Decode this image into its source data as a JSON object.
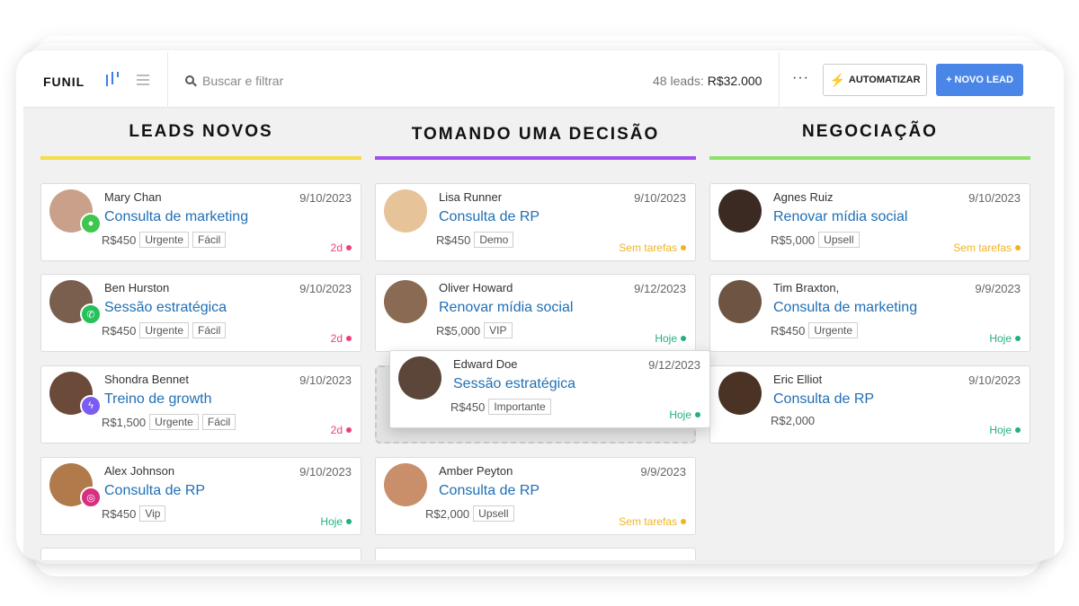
{
  "toolbar": {
    "title": "FUNIL",
    "search_placeholder": "Buscar e filtrar",
    "leads_count": "48 leads:",
    "leads_total": "R$32.000",
    "more": "···",
    "automate_label": "AUTOMATIZAR",
    "new_lead_label": "+ NOVO LEAD"
  },
  "colors": {
    "accent": "#4a86e8",
    "link": "#1f6fb5",
    "today": "#22b07d",
    "no_tasks": "#f0b323",
    "overdue": "#ec407a"
  },
  "columns": [
    {
      "title": "LEADS NOVOS",
      "line_color": "#f4dc4a",
      "cards": [
        {
          "name": "Mary Chan",
          "date": "9/10/2023",
          "title": "Consulta de marketing",
          "price": "R$450",
          "tags": [
            "Urgente",
            "Fácil"
          ],
          "status": "2d",
          "status_kind": "overdue",
          "channel": "chat-icon",
          "avatar_color": "#c9a18a"
        },
        {
          "name": "Ben Hurston",
          "date": "9/10/2023",
          "title": "Sessão estratégica",
          "price": "R$450",
          "tags": [
            "Urgente",
            "Fácil"
          ],
          "status": "2d",
          "status_kind": "overdue",
          "channel": "whatsapp-icon",
          "avatar_color": "#7a5f4e"
        },
        {
          "name": "Shondra Bennet",
          "date": "9/10/2023",
          "title": "Treino de growth",
          "price": "R$1,500",
          "tags": [
            "Urgente",
            "Fácil"
          ],
          "status": "2d",
          "status_kind": "overdue",
          "channel": "messenger-icon",
          "avatar_color": "#6b4a3a"
        },
        {
          "name": "Alex Johnson",
          "date": "9/10/2023",
          "title": "Consulta de RP",
          "price": "R$450",
          "tags": [
            "Vip"
          ],
          "status": "Hoje",
          "status_kind": "today",
          "channel": "instagram-icon",
          "avatar_color": "#b07a4a"
        }
      ]
    },
    {
      "title": "TOMANDO UMA DECISÃO",
      "line_color": "#a14ef2",
      "cards": [
        {
          "name": "Lisa Runner",
          "date": "9/10/2023",
          "title": "Consulta de RP",
          "price": "R$450",
          "tags": [
            "Demo"
          ],
          "status": "Sem tarefas",
          "status_kind": "no_tasks",
          "channel": "",
          "avatar_color": "#e7c39a"
        },
        {
          "name": "Oliver Howard",
          "date": "9/12/2023",
          "title": "Renovar mídia social",
          "price": "R$5,000",
          "tags": [
            "VIP"
          ],
          "status": "Hoje",
          "status_kind": "today",
          "channel": "",
          "avatar_color": "#8a6a52"
        },
        {
          "name": "Amber Peyton",
          "date": "9/9/2023",
          "title": "Consulta de RP",
          "price": "R$2,000",
          "tags": [
            "Upsell"
          ],
          "status": "Sem tarefas",
          "status_kind": "no_tasks",
          "channel": "",
          "avatar_color": "#c98f6b"
        }
      ],
      "dragged_card": {
        "name": "Edward Doe",
        "date": "9/12/2023",
        "title": "Sessão estratégica",
        "price": "R$450",
        "tags": [
          "Importante"
        ],
        "status": "Hoje",
        "status_kind": "today",
        "avatar_color": "#5b4639"
      }
    },
    {
      "title": "NEGOCIAÇÃO",
      "line_color": "#8fe06a",
      "cards": [
        {
          "name": "Agnes Ruiz",
          "date": "9/10/2023",
          "title": "Renovar mídia social",
          "price": "R$5,000",
          "tags": [
            "Upsell"
          ],
          "status": "Sem tarefas",
          "status_kind": "no_tasks",
          "channel": "",
          "avatar_color": "#3b2a22"
        },
        {
          "name": "Tim Braxton,",
          "date": "9/9/2023",
          "title": "Consulta de marketing",
          "price": "R$450",
          "tags": [
            "Urgente"
          ],
          "status": "Hoje",
          "status_kind": "today",
          "channel": "",
          "avatar_color": "#6e5442"
        },
        {
          "name": "Eric Elliot",
          "date": "9/10/2023",
          "title": "Consulta de RP",
          "price": "R$2,000",
          "tags": [],
          "status": "Hoje",
          "status_kind": "today",
          "channel": "",
          "avatar_color": "#4a3224"
        }
      ]
    }
  ]
}
